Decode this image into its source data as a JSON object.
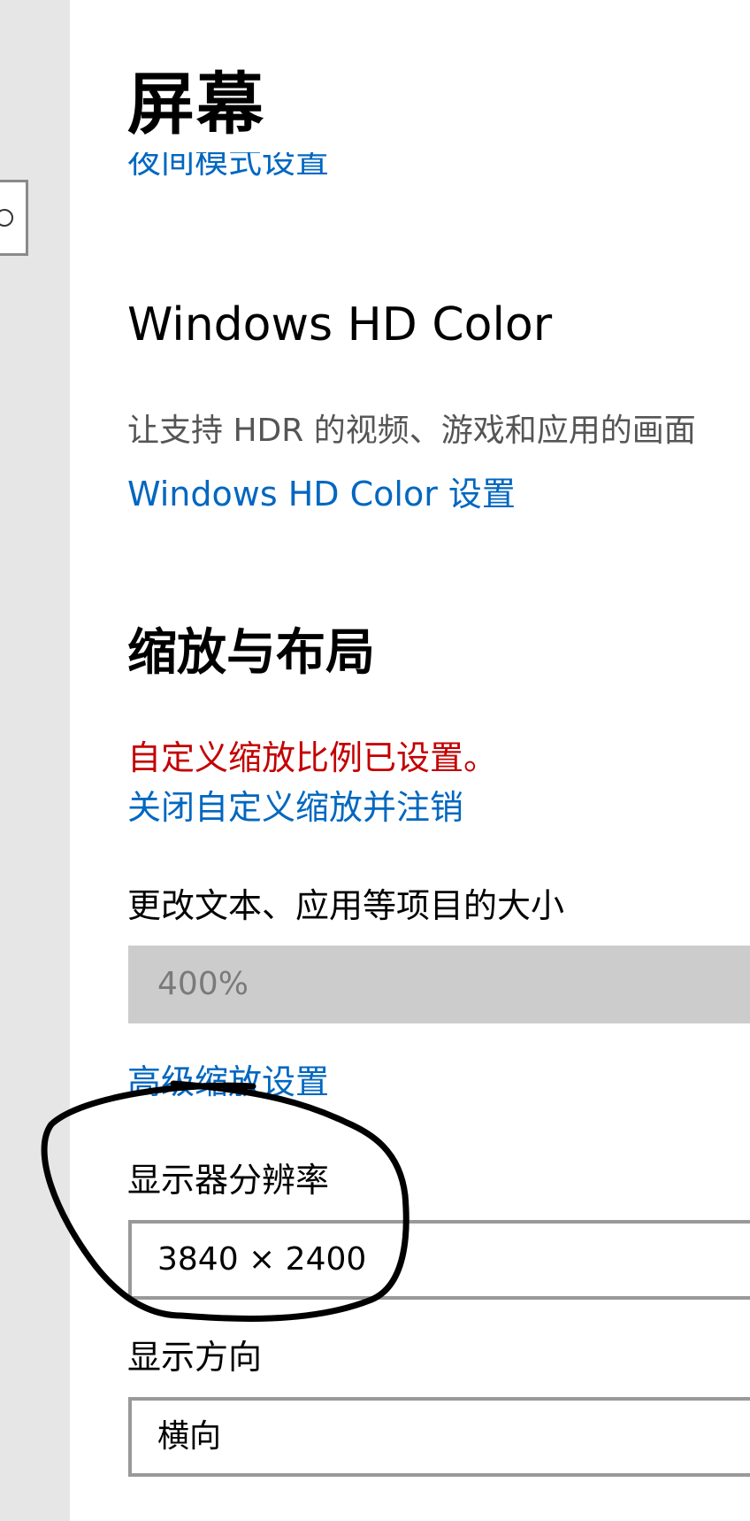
{
  "page": {
    "title": "屏幕"
  },
  "night_light": {
    "link_label": "夜间模式设置"
  },
  "hd_color": {
    "heading": "Windows HD Color",
    "description": "让支持 HDR 的视频、游戏和应用的画面",
    "link_label": "Windows HD Color 设置"
  },
  "scale_layout": {
    "heading": "缩放与布局",
    "custom_scale_warning": "自定义缩放比例已设置。",
    "turn_off_link": "关闭自定义缩放并注销",
    "scale_label": "更改文本、应用等项目的大小",
    "scale_value": "400%",
    "advanced_link": "高级缩放设置",
    "resolution_label": "显示器分辨率",
    "resolution_value": "3840 × 2400",
    "orientation_label": "显示方向",
    "orientation_value": "横向"
  },
  "icons": {
    "nav_search": "search-icon"
  },
  "colors": {
    "link": "#0067c0",
    "warning": "#c40000",
    "nav_background": "#e6e6e6",
    "disabled_dropdown": "#cccccc",
    "annotation_stroke": "#000000"
  }
}
